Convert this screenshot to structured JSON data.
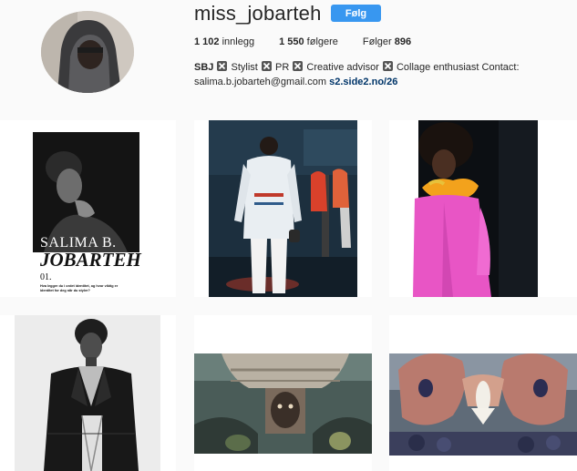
{
  "profile": {
    "username": "miss_jobarteh",
    "follow_label": "Følg",
    "stats": {
      "posts_count": "1 102",
      "posts_label": "innlegg",
      "followers_count": "1 550",
      "followers_label": "følgere",
      "following_label": "Følger",
      "following_count": "896"
    },
    "bio": {
      "initials": "SBJ",
      "part1": " Stylist ",
      "part2": " PR ",
      "part3": " Creative advisor ",
      "part4": " Collage enthusiast Contact:",
      "email": "salima.b.jobarteh@gmail.com",
      "link": "s2.side2.no/26"
    }
  },
  "posts": {
    "magazine": {
      "name_line1": "SALIMA B.",
      "name_line2": "JOBARTEH",
      "number": "01.",
      "caption_line1": "Hva legger du i ordet identitet, og hvor viktig er",
      "caption_line2": "identitet for deg når du styler?"
    }
  },
  "colors": {
    "accent": "#3897f0",
    "link": "#003569",
    "background": "#fafafa"
  }
}
